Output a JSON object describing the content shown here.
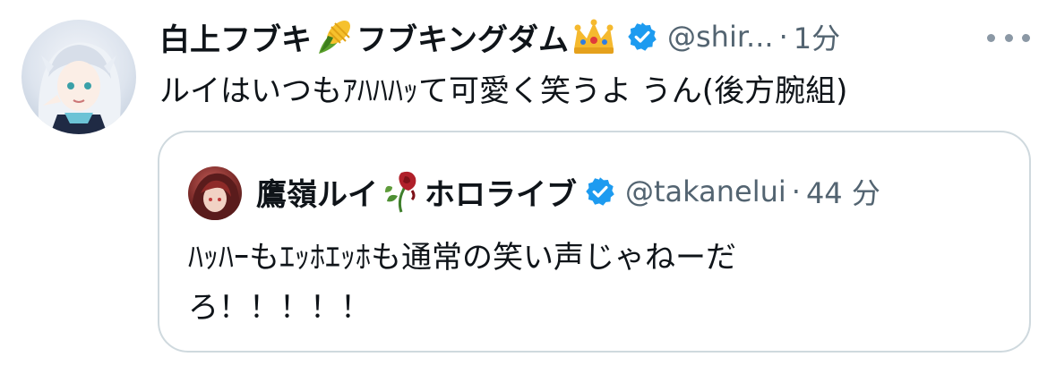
{
  "tweet": {
    "author_name_part1": "白上フブキ",
    "author_name_part2": "フブキングダム",
    "emoji1": "corn-emoji",
    "emoji2": "crown-emoji",
    "handle": "@shir...",
    "separator": "·",
    "time": "1分",
    "text": "ルイはいつもｱﾊﾊﾊｯて可愛く笑うよ うん(後方腕組)"
  },
  "quote": {
    "author_name_part1": "鷹嶺ルイ",
    "author_name_part2": "ホロライブ",
    "emoji": "wilted-rose-emoji",
    "handle": "@takanelui",
    "separator": "·",
    "time": "44 分",
    "text": "ﾊｯﾊｰもｴｯﾎｴｯﾎも通常の笑い声じゃねーだろ！！！！！"
  },
  "colors": {
    "verified": "#1d9bf0",
    "secondary_text": "#536471",
    "border": "#cfd9de"
  }
}
